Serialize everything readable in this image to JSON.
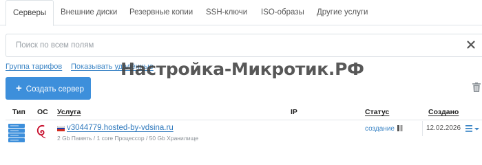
{
  "tabs": [
    {
      "label": "Серверы",
      "active": true
    },
    {
      "label": "Внешние диски"
    },
    {
      "label": "Резервные копии"
    },
    {
      "label": "SSH-ключи"
    },
    {
      "label": "ISO-образы"
    },
    {
      "label": "Другие услуги"
    }
  ],
  "search": {
    "placeholder": "Поиск по всем полям",
    "value": ""
  },
  "links": {
    "tariff_group": "Группа тарифов",
    "show_deleted": "Показывать удалённые"
  },
  "watermark": "Настройка-Микротик.РФ",
  "toolbar": {
    "create_label": "Создать сервер"
  },
  "table": {
    "headers": {
      "type": "Тип",
      "os": "ОС",
      "service": "Услуга",
      "ip": "IP",
      "status": "Статус",
      "created": "Создано"
    },
    "rows": [
      {
        "type_icon": "server-rack-icon",
        "os_icon": "debian-icon",
        "flag": "ru-flag-icon",
        "hostname": "v3044779.hosted-by-vdsina.ru",
        "specs": "2 Gb Память / 1 core Процессор / 50 Gb Хранилище",
        "ip": "",
        "status": "создание",
        "created": "12.02.2026"
      }
    ]
  },
  "colors": {
    "accent": "#3d8fdb",
    "link": "#3d86c6",
    "border": "#dde2e6"
  }
}
